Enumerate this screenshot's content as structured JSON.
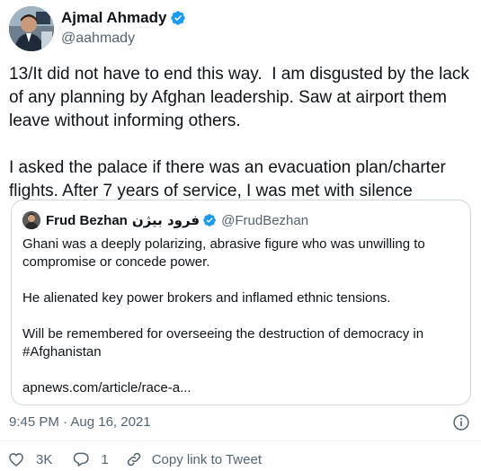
{
  "author": {
    "display_name": "Ajmal Ahmady",
    "handle": "@aahmady",
    "verified_icon": "verified-badge-icon",
    "avatar_icon": "avatar"
  },
  "tweet": {
    "text": "13/It did not have to end this way.  I am disgusted by the lack of any planning by Afghan leadership. Saw at airport them leave without informing others.\n\nI asked the palace if there was an evacuation plan/charter flights. After 7 years of service, I was met with silence"
  },
  "quoted_tweet": {
    "display_name": "Frud Bezhan",
    "display_name_arabic": "فرود بیژن",
    "handle": "@FrudBezhan",
    "text": "Ghani was a deeply polarizing, abrasive figure who was unwilling to compromise or concede power.\n\nHe alienated key power brokers and inflamed ethnic tensions.\n\nWill be remembered for overseeing the destruction of democracy in #Afghanistan\n\napnews.com/article/race-a..."
  },
  "meta": {
    "timestamp": "9:45 PM · Aug 16, 2021",
    "info_icon": "info-icon"
  },
  "actions": {
    "like_count": "3K",
    "reply_count": "1",
    "copy_link_label": "Copy link to Tweet"
  },
  "colors": {
    "verified_blue": "#1d9bf0",
    "secondary_text": "#536471",
    "border": "#cfd9de"
  }
}
